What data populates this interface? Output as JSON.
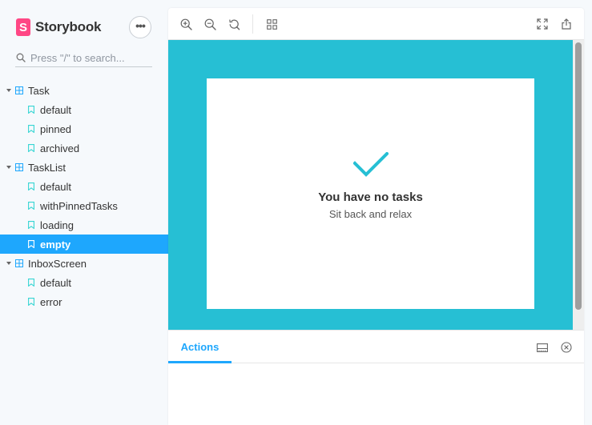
{
  "brand": {
    "name": "Storybook",
    "logo_letter": "S",
    "color": "#ff4785"
  },
  "menu_button": {
    "label": "•••"
  },
  "search": {
    "placeholder": "Press \"/\" to search..."
  },
  "tree": {
    "task": {
      "label": "Task",
      "stories": [
        "default",
        "pinned",
        "archived"
      ]
    },
    "tasklist": {
      "label": "TaskList",
      "stories": [
        "default",
        "withPinnedTasks",
        "loading",
        "empty"
      ]
    },
    "inbox": {
      "label": "InboxScreen",
      "stories": [
        "default",
        "error"
      ]
    },
    "selected": "TaskList/empty",
    "selected_color": "#1ea7fd"
  },
  "toolbar": {
    "zoom_in": "zoom-in-icon",
    "zoom_out": "zoom-out-icon",
    "zoom_reset": "zoom-reset-icon",
    "grid": "grid-icon",
    "fullscreen": "fullscreen-icon",
    "share": "share-icon"
  },
  "preview": {
    "background": "#26bfd4",
    "empty_title": "You have no tasks",
    "empty_subtitle": "Sit back and relax"
  },
  "addons": {
    "active_tab": "Actions",
    "accent": "#1ea7fd"
  }
}
